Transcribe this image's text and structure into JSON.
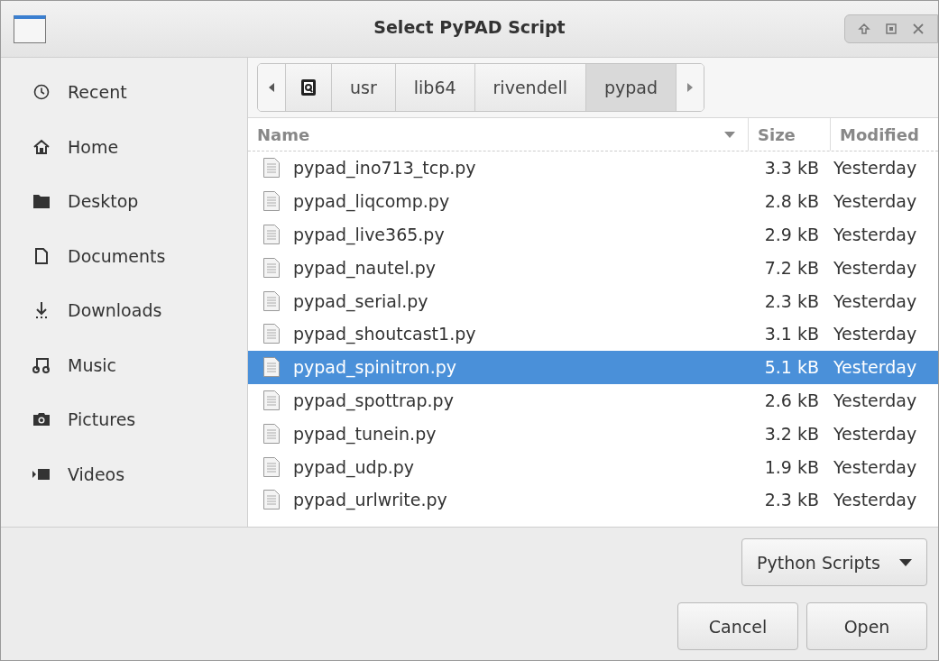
{
  "window": {
    "title": "Select PyPAD Script"
  },
  "sidebar": {
    "items": [
      {
        "label": "Recent",
        "kind": "recent",
        "selected": false
      },
      {
        "label": "Home",
        "kind": "home",
        "selected": false
      },
      {
        "label": "Desktop",
        "kind": "folder",
        "selected": false
      },
      {
        "label": "Documents",
        "kind": "document",
        "selected": false
      },
      {
        "label": "Downloads",
        "kind": "download",
        "selected": false
      },
      {
        "label": "Music",
        "kind": "music",
        "selected": false
      },
      {
        "label": "Pictures",
        "kind": "camera",
        "selected": false
      },
      {
        "label": "Videos",
        "kind": "video",
        "selected": false
      }
    ]
  },
  "path_bar": {
    "segments": [
      {
        "kind": "drive",
        "selected": false
      },
      {
        "label": "usr",
        "kind": "text",
        "selected": false
      },
      {
        "label": "lib64",
        "kind": "text",
        "selected": false
      },
      {
        "label": "rivendell",
        "kind": "text",
        "selected": false
      },
      {
        "label": "pypad",
        "kind": "text",
        "selected": true
      }
    ]
  },
  "table": {
    "columns": [
      "Name",
      "Size",
      "Modified"
    ],
    "rows": [
      {
        "name": "pypad_ino713_tcp.py",
        "size": "3.3 kB",
        "modified": "Yesterday",
        "selected": false
      },
      {
        "name": "pypad_liqcomp.py",
        "size": "2.8 kB",
        "modified": "Yesterday",
        "selected": false
      },
      {
        "name": "pypad_live365.py",
        "size": "2.9 kB",
        "modified": "Yesterday",
        "selected": false
      },
      {
        "name": "pypad_nautel.py",
        "size": "7.2 kB",
        "modified": "Yesterday",
        "selected": false
      },
      {
        "name": "pypad_serial.py",
        "size": "2.3 kB",
        "modified": "Yesterday",
        "selected": false
      },
      {
        "name": "pypad_shoutcast1.py",
        "size": "3.1 kB",
        "modified": "Yesterday",
        "selected": false
      },
      {
        "name": "pypad_spinitron.py",
        "size": "5.1 kB",
        "modified": "Yesterday",
        "selected": true
      },
      {
        "name": "pypad_spottrap.py",
        "size": "2.6 kB",
        "modified": "Yesterday",
        "selected": false
      },
      {
        "name": "pypad_tunein.py",
        "size": "3.2 kB",
        "modified": "Yesterday",
        "selected": false
      },
      {
        "name": "pypad_udp.py",
        "size": "1.9 kB",
        "modified": "Yesterday",
        "selected": false
      },
      {
        "name": "pypad_urlwrite.py",
        "size": "2.3 kB",
        "modified": "Yesterday",
        "selected": false
      }
    ]
  },
  "filter": {
    "value": "Python Scripts"
  },
  "buttons": [
    "Cancel",
    "Open"
  ]
}
